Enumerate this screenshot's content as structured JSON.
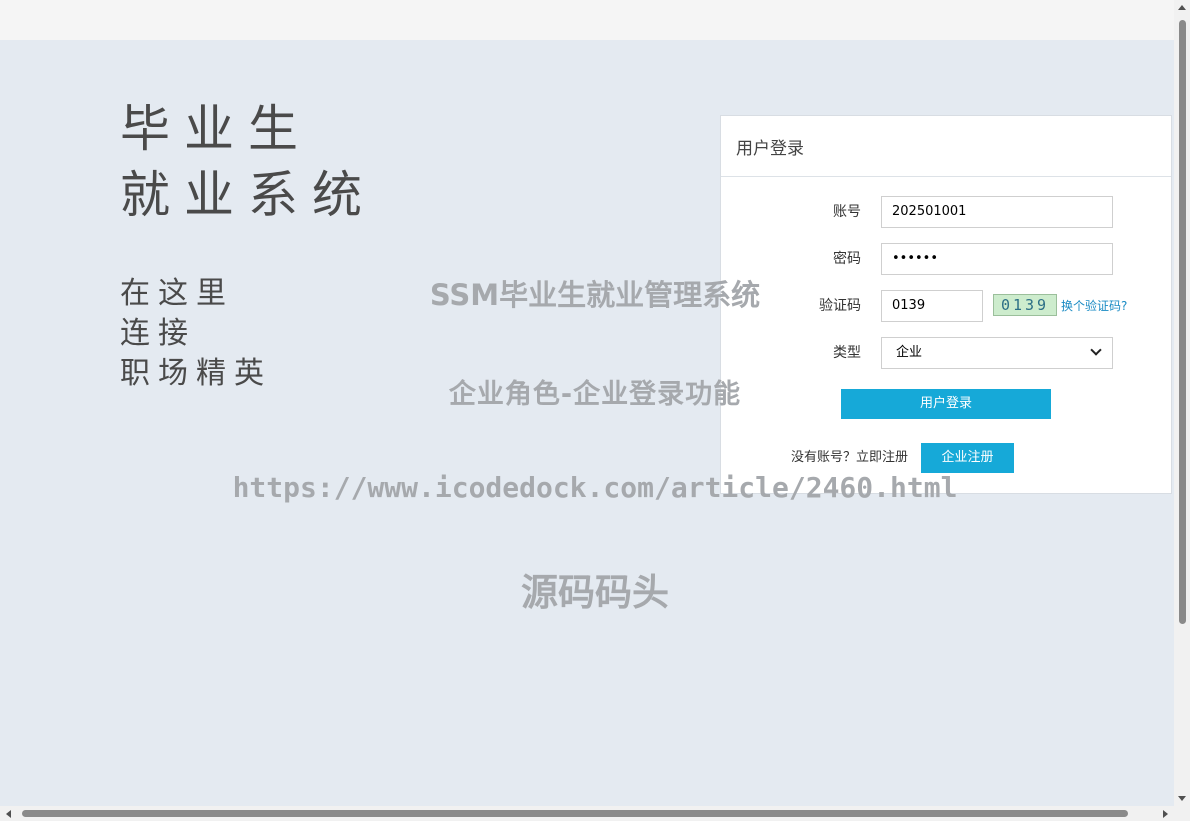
{
  "hero": {
    "title_line1": "毕业生",
    "title_line2": "就业系统",
    "tag_line1": "在这里",
    "tag_line2": "连接",
    "tag_line3": "职场精英"
  },
  "login": {
    "header": "用户登录",
    "account_label": "账号",
    "account_value": "202501001",
    "password_label": "密码",
    "password_value": "••••••",
    "captcha_label": "验证码",
    "captcha_value": "0139",
    "captcha_image_text": "0139",
    "captcha_refresh": "换个验证码?",
    "type_label": "类型",
    "type_selected": "企业",
    "submit_label": "用户登录",
    "register_prompt": "没有账号？立即注册",
    "register_button": "企业注册"
  },
  "watermark": {
    "line1": "SSM毕业生就业管理系统",
    "line2": "企业角色-企业登录功能",
    "line3": "https://www.icodedock.com/article/2460.html",
    "line4": "源码码头"
  },
  "colors": {
    "page_bg": "#e4eaf1",
    "accent": "#16a9d8",
    "link": "#1a8bc4"
  }
}
